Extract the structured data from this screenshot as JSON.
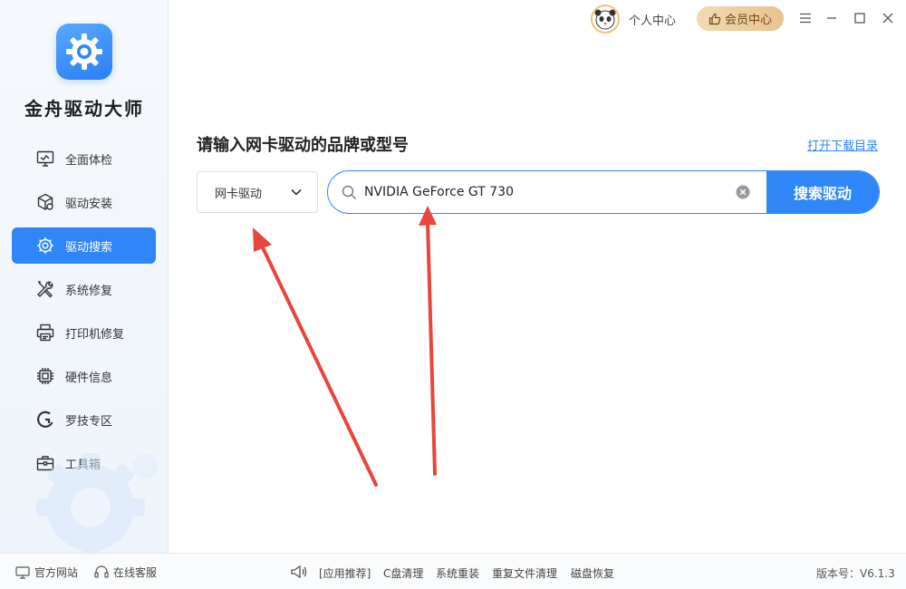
{
  "app": {
    "name": "金舟驱动大师"
  },
  "sidebar": {
    "items": [
      {
        "label": "全面体检",
        "icon": "monitor-check-icon",
        "active": false
      },
      {
        "label": "驱动安装",
        "icon": "package-install-icon",
        "active": false
      },
      {
        "label": "驱动搜索",
        "icon": "gear-search-icon",
        "active": true
      },
      {
        "label": "系统修复",
        "icon": "wrench-screwdriver-icon",
        "active": false
      },
      {
        "label": "打印机修复",
        "icon": "printer-icon",
        "active": false
      },
      {
        "label": "硬件信息",
        "icon": "chip-icon",
        "active": false
      },
      {
        "label": "罗技专区",
        "icon": "logitech-icon",
        "active": false
      },
      {
        "label": "工具箱",
        "icon": "toolbox-icon",
        "active": false
      }
    ]
  },
  "titlebar": {
    "personal_center": "个人中心",
    "vip_center": "会员中心"
  },
  "main": {
    "heading": "请输入网卡驱动的品牌或型号",
    "open_download_dir": "打开下载目录",
    "driver_type_select": "网卡驱动",
    "search_value": "NVIDIA GeForce GT 730",
    "search_button": "搜索驱动"
  },
  "footer": {
    "official_site": "官方网站",
    "online_service": "在线客服",
    "recommend_label": "[应用推荐]",
    "links": [
      "C盘清理",
      "系统重装",
      "重复文件清理",
      "磁盘恢复"
    ],
    "version": "版本号：V6.1.3"
  },
  "colors": {
    "accent": "#2f86f6",
    "vip_gold": "#e9c38e",
    "annotation_arrow": "#e8453c"
  }
}
